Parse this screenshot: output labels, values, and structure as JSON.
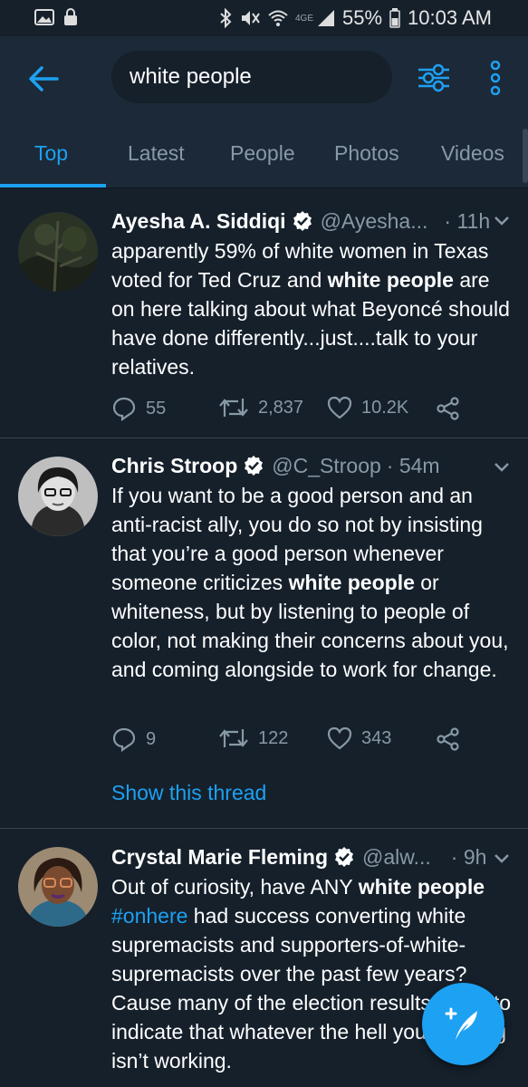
{
  "status_bar": {
    "battery": "55%",
    "time": "10:03 AM",
    "network": "4GE"
  },
  "search": {
    "query": "white people"
  },
  "tabs": [
    {
      "label": "Top",
      "active": true
    },
    {
      "label": "Latest",
      "active": false
    },
    {
      "label": "People",
      "active": false
    },
    {
      "label": "Photos",
      "active": false
    },
    {
      "label": "Videos",
      "active": false
    }
  ],
  "tweets": [
    {
      "name": "Ayesha A. Siddiqi",
      "handle": "@Ayesha...",
      "time": "· 11h",
      "text_parts": [
        "apparently 59% of white women in Texas voted for Ted Cruz and ",
        "white people",
        " are on here talking about what Beyoncé should have done differently...just....talk to your relatives."
      ],
      "replies": "55",
      "retweets": "2,837",
      "likes": "10.2K"
    },
    {
      "name": "Chris Stroop",
      "handle": "@C_Stroop",
      "time": "· 54m",
      "text_parts": [
        "If you want to be a good person and an anti-racist ally, you do so not by insisting that you’re a good person whenever someone criticizes ",
        "white people",
        " or whiteness, but by listening to people of color, not making their concerns about you, and coming alongside to work for change."
      ],
      "replies": "9",
      "retweets": "122",
      "likes": "343",
      "thread_link": "Show this thread"
    },
    {
      "name": "Crystal Marie Fleming",
      "handle": "@alw...",
      "time": "· 9h",
      "text_parts": [
        "Out of curiosity, have ANY ",
        "white people",
        " ",
        "#onhere",
        " had success converting white supremacists and supporters-of-white-supremacists over the past few years? Cause many of the election results seem to indicate that whatever the hell you’re doing isn’t working."
      ]
    }
  ],
  "colors": {
    "accent": "#1da1f2",
    "background": "#15202b",
    "bar": "#1c2938",
    "muted": "#8899a6"
  },
  "icons": [
    "back-arrow-icon",
    "filter-sliders-icon",
    "more-vertical-icon",
    "reply-icon",
    "retweet-icon",
    "like-icon",
    "share-icon",
    "verified-badge-icon",
    "chevron-down-icon",
    "compose-tweet-icon"
  ]
}
